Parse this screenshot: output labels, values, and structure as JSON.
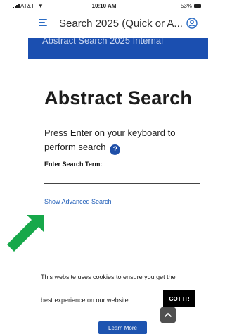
{
  "status_bar": {
    "carrier": "AT&T",
    "time": "10:10 AM",
    "battery": "53%"
  },
  "header": {
    "title": "Search 2025 (Quick or A...",
    "menu_icon": "hamburger-menu-icon",
    "user_icon": "user-circle-icon"
  },
  "banner": {
    "text": "Abstract Search 2025 Internal"
  },
  "main": {
    "title": "Abstract Search",
    "instructions": "Press Enter on your keyboard to perform search",
    "help_icon_glyph": "?",
    "term_label": "Enter Search Term:",
    "search_value": "",
    "advanced_link": "Show Advanced Search"
  },
  "cookie_notice": {
    "line1": "This website uses cookies to ensure you get the",
    "line2": "best experience on our website.",
    "got_it": "GOT IT!",
    "learn_more": "Learn More"
  },
  "colors": {
    "accent_blue": "#1b4fb0",
    "link_blue": "#1f5db8",
    "arrow_green": "#17a84a"
  }
}
